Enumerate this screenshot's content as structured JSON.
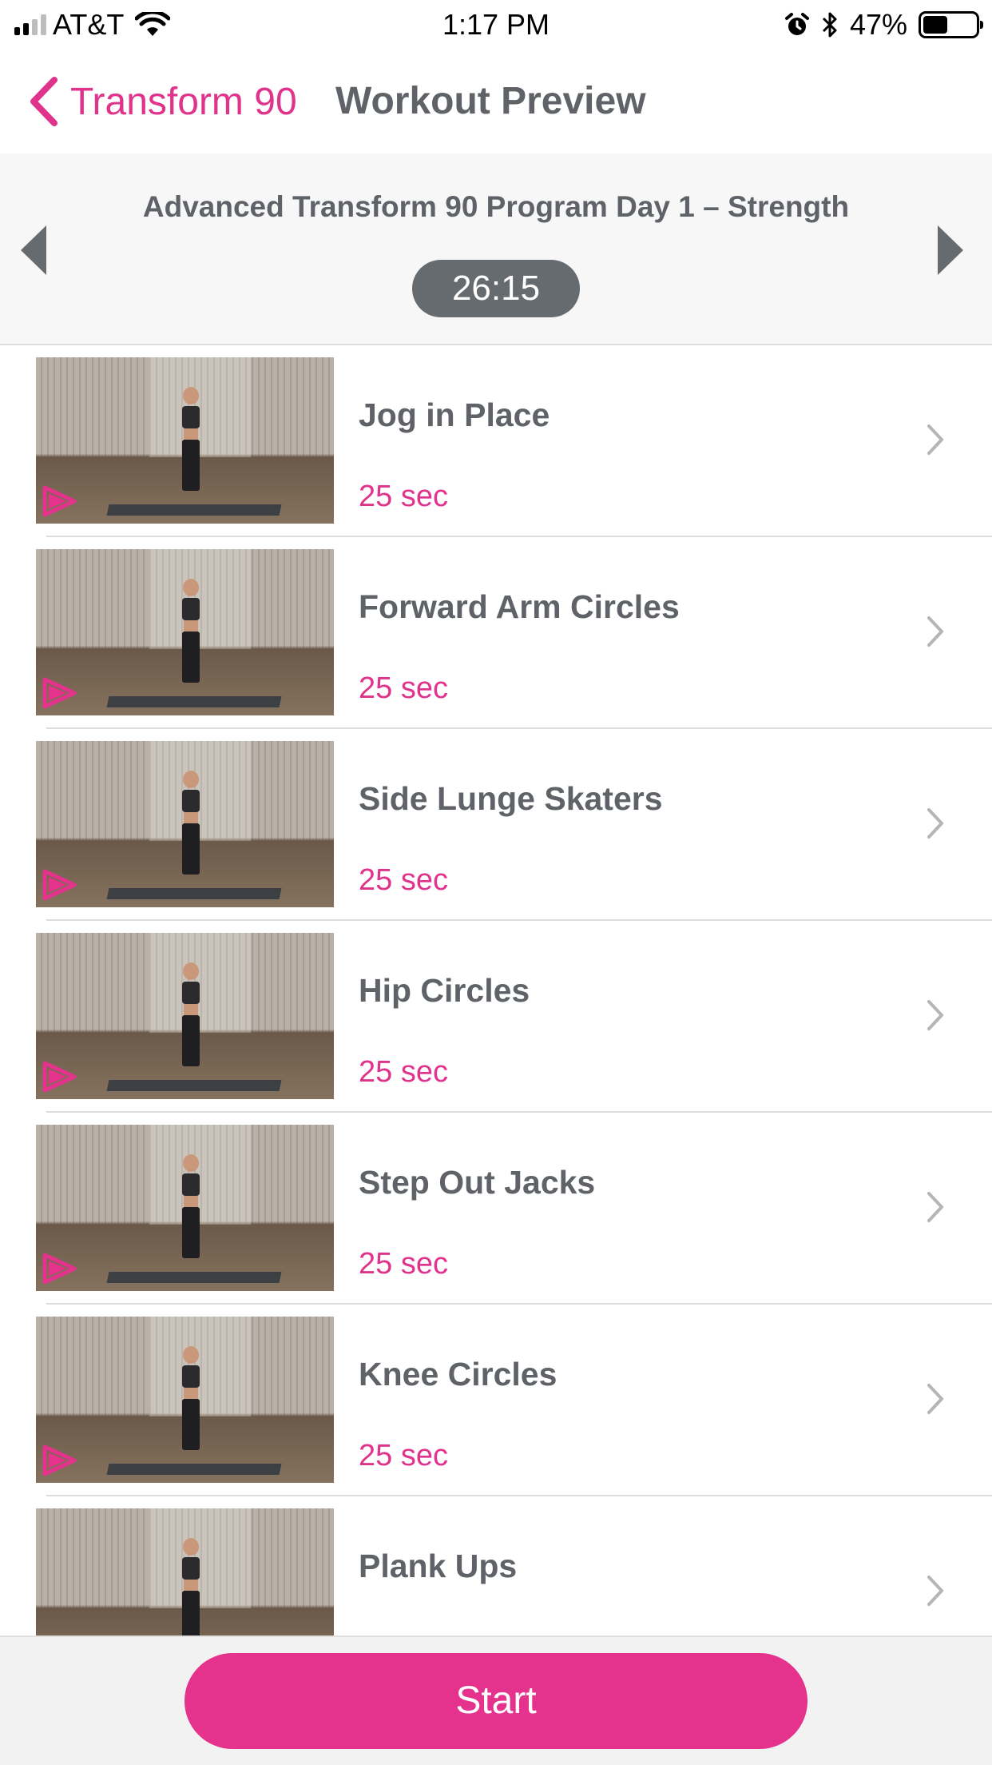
{
  "status_bar": {
    "carrier": "AT&T",
    "time": "1:17 PM",
    "battery_percent": "47%",
    "battery_level": 0.47,
    "signal_bars": 2,
    "icons": [
      "signal-icon",
      "wifi-icon",
      "alarm-icon",
      "bluetooth-icon",
      "battery-icon"
    ]
  },
  "nav": {
    "back_label": "Transform 90",
    "title": "Workout Preview"
  },
  "workout": {
    "program_title": "Advanced Transform 90 Program Day 1 – Strength",
    "duration": "26:15"
  },
  "exercises": [
    {
      "name": "Jog in Place",
      "duration": "25 sec"
    },
    {
      "name": "Forward Arm Circles",
      "duration": "25 sec"
    },
    {
      "name": "Side Lunge Skaters",
      "duration": "25 sec"
    },
    {
      "name": "Hip Circles",
      "duration": "25 sec"
    },
    {
      "name": "Step Out Jacks",
      "duration": "25 sec"
    },
    {
      "name": "Knee Circles",
      "duration": "25 sec"
    },
    {
      "name": "Plank Ups",
      "duration": ""
    }
  ],
  "actions": {
    "start_label": "Start"
  },
  "colors": {
    "accent": "#e5338d",
    "text_gray": "#5f6368",
    "pill_gray": "#666b70"
  }
}
